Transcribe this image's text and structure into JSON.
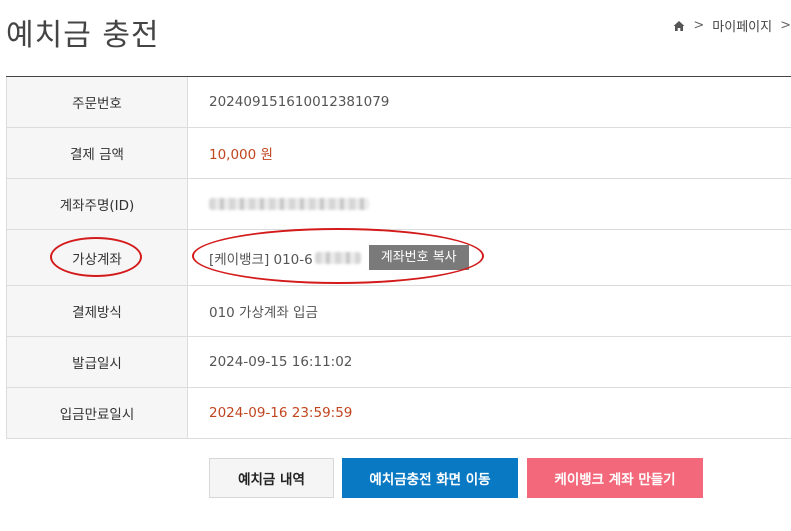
{
  "header": {
    "title": "예치금 충전",
    "breadcrumb": {
      "current": "마이페이지"
    }
  },
  "order_table": [
    {
      "label": "주문번호",
      "value": "20240915161001238107 9"
    },
    {
      "label": "결제 금액",
      "value": "10,000 원"
    },
    {
      "label": "계좌주명(ID)",
      "value": ""
    },
    {
      "label": "가상계좌",
      "value": "[케이뱅크] 010-6"
    },
    {
      "label": "결제방식",
      "value": "010 가상계좌 입금"
    },
    {
      "label": "발급일시",
      "value": "2024-09-15 16:11:02"
    },
    {
      "label": "입금만료일시",
      "value": "2024-09-16 23:59:59"
    }
  ],
  "copy_button": "계좌번호 복사",
  "actions": {
    "history": "예치금 내역",
    "move": "예치금충전 화면 이동",
    "kbank": "케이뱅크 계좌 만들기"
  },
  "colors": {
    "accent_red": "#c0451f",
    "annotation_red": "#d41b1b",
    "primary_blue": "#0a79c4",
    "pink": "#f3687a"
  }
}
